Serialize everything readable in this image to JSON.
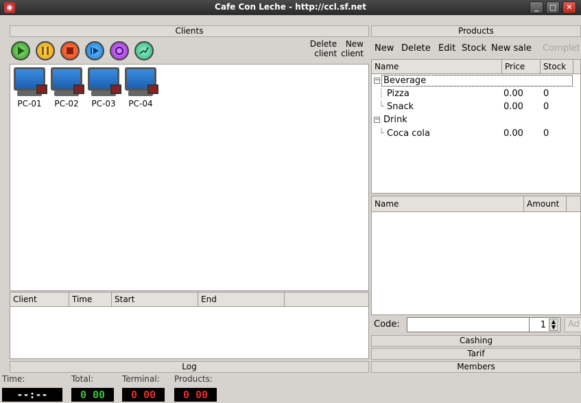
{
  "window": {
    "title": "Cafe Con Leche - http://ccl.sf.net"
  },
  "clients_panel": {
    "header": "Clients",
    "delete_label": [
      "Delete",
      "client"
    ],
    "new_label": [
      "New",
      "client"
    ],
    "clients": [
      "PC-01",
      "PC-02",
      "PC-03",
      "PC-04"
    ]
  },
  "log_panel": {
    "header": "Log",
    "columns": [
      "Client",
      "Time",
      "Start",
      "End",
      ""
    ]
  },
  "products_panel": {
    "header": "Products",
    "toolbar": [
      "New",
      "Delete",
      "Edit",
      "Stock",
      "New sale",
      "Complet"
    ],
    "columns": [
      "Name",
      "Price",
      "Stock"
    ],
    "tree": [
      {
        "name": "Beverage",
        "group": true
      },
      {
        "name": "Pizza",
        "price": "0.00",
        "stock": "0"
      },
      {
        "name": "Snack",
        "price": "0.00",
        "stock": "0"
      },
      {
        "name": "Drink",
        "group": true
      },
      {
        "name": "Coca cola",
        "price": "0.00",
        "stock": "0"
      }
    ],
    "sale_columns": [
      "Name",
      "Amount"
    ],
    "code_label": "Code:",
    "code_value": "",
    "amount_value": "1",
    "add_label": "Ad"
  },
  "side_sections": [
    "Cashing",
    "Tarif",
    "Members"
  ],
  "status": {
    "time_label": "Time:",
    "total_label": "Total:",
    "terminal_label": "Terminal:",
    "products_label": "Products:",
    "time_value": "--:--",
    "total_value": "0 00",
    "terminal_value": "0 00",
    "products_value": "0 00",
    "colors": {
      "total": "#3cc23c",
      "terminal": "#e03030",
      "products": "#e03030"
    }
  }
}
